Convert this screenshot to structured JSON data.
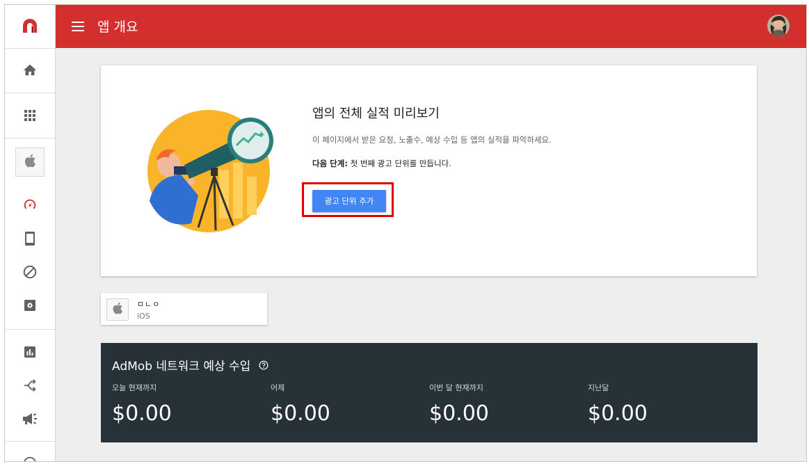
{
  "header": {
    "title": "앱 개요"
  },
  "hero": {
    "heading": "앱의 전체 실적 미리보기",
    "description": "이 페이지에서 받은 요청, 노출수, 예상 수입 등 앱의 실적을 파악하세요.",
    "next_label": "다음 단계:",
    "next_text": " 첫 번째 광고 단위를 만듭니다.",
    "button": "광고 단위 추가"
  },
  "app": {
    "name": "ㅁㄴㅇ",
    "platform": "iOS"
  },
  "earnings": {
    "title": "AdMob 네트워크 예상 수입",
    "items": [
      {
        "label": "오늘 현재까지",
        "value": "$0.00"
      },
      {
        "label": "어제",
        "value": "$0.00"
      },
      {
        "label": "이번 달 현재까지",
        "value": "$0.00"
      },
      {
        "label": "지난달",
        "value": "$0.00"
      }
    ]
  },
  "colors": {
    "header": "#d32f2f",
    "button": "#4285f4",
    "earnings_bg": "#263238",
    "highlight": "#e00000",
    "active_icon": "#d32f2f"
  },
  "icons": [
    "admob-logo-icon",
    "home-icon",
    "apps-grid-icon",
    "apple-icon",
    "dashboard-gauge-icon",
    "mobile-icon",
    "block-icon",
    "settings-box-icon",
    "reports-icon",
    "mediation-icon",
    "campaigns-icon",
    "help-icon"
  ]
}
